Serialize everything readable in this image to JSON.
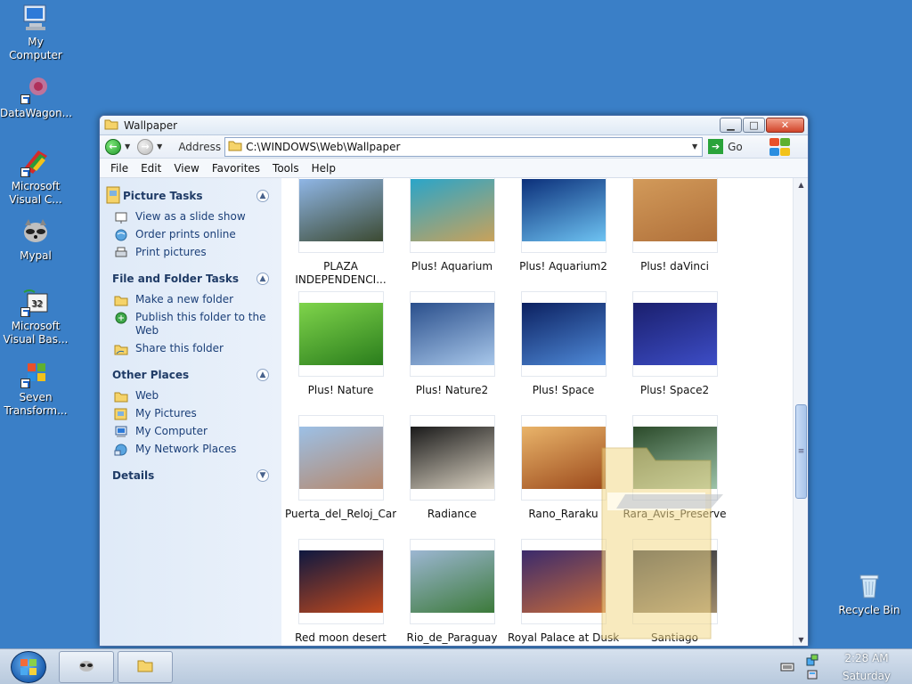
{
  "desktop": {
    "icons": [
      {
        "label": "My Computer"
      },
      {
        "label": "DataWagon..."
      },
      {
        "label": "Microsoft Visual C..."
      },
      {
        "label": "Mypal"
      },
      {
        "label": "Microsoft Visual Bas..."
      },
      {
        "label": "Seven Transform..."
      },
      {
        "label": "Recycle Bin"
      }
    ]
  },
  "window": {
    "title": "Wallpaper",
    "address_label": "Address",
    "address_value": "C:\\WINDOWS\\Web\\Wallpaper",
    "go_label": "Go",
    "menu": [
      "File",
      "Edit",
      "View",
      "Favorites",
      "Tools",
      "Help"
    ]
  },
  "taskpane": {
    "picture_tasks": {
      "title": "Picture Tasks",
      "items": [
        "View as a slide show",
        "Order prints online",
        "Print pictures"
      ]
    },
    "file_folder_tasks": {
      "title": "File and Folder Tasks",
      "items": [
        "Make a new folder",
        "Publish this folder to the Web",
        "Share this folder"
      ]
    },
    "other_places": {
      "title": "Other Places",
      "items": [
        "Web",
        "My Pictures",
        "My Computer",
        "My Network Places"
      ]
    },
    "details": {
      "title": "Details"
    }
  },
  "files": [
    {
      "label": "PLAZA INDEPENDENCI...",
      "colors": [
        "#8fb6e6",
        "#3c4a32"
      ]
    },
    {
      "label": "Plus! Aquarium",
      "colors": [
        "#2aa5c9",
        "#c9a25a"
      ]
    },
    {
      "label": "Plus! Aquarium2",
      "colors": [
        "#0b2f7a",
        "#6ec3f2"
      ]
    },
    {
      "label": "Plus! daVinci",
      "colors": [
        "#d29a5a",
        "#b0703a"
      ]
    },
    {
      "label": "Plus! Nature",
      "colors": [
        "#7fd44b",
        "#2a7d1c"
      ]
    },
    {
      "label": "Plus! Nature2",
      "colors": [
        "#2a4f8c",
        "#a8c7ea"
      ]
    },
    {
      "label": "Plus! Space",
      "colors": [
        "#0b2060",
        "#4f8ad8"
      ]
    },
    {
      "label": "Plus! Space2",
      "colors": [
        "#1a1f6d",
        "#3d4dc6"
      ]
    },
    {
      "label": "Puerta_del_Reloj_Car...",
      "colors": [
        "#9cc0e6",
        "#b6876a"
      ]
    },
    {
      "label": "Radiance",
      "colors": [
        "#1a1a1a",
        "#d8d0c0"
      ]
    },
    {
      "label": "Rano_Raraku",
      "colors": [
        "#e9b46a",
        "#9c4a1c"
      ]
    },
    {
      "label": "Rara_Avis_Preserve",
      "colors": [
        "#2b4a2a",
        "#9cc2a8"
      ]
    },
    {
      "label": "Red moon desert",
      "colors": [
        "#0e1840",
        "#c44a1c"
      ]
    },
    {
      "label": "Rio_de_Paraguay",
      "colors": [
        "#9cb6d2",
        "#3c7a3a"
      ]
    },
    {
      "label": "Royal Palace at Dusk",
      "colors": [
        "#3a2a6c",
        "#c66a3a"
      ]
    },
    {
      "label": "Santiago",
      "colors": [
        "#202838",
        "#a08c6c"
      ]
    }
  ],
  "taskbar": {
    "clock_time": "2:28 AM",
    "clock_day": "Saturday"
  }
}
